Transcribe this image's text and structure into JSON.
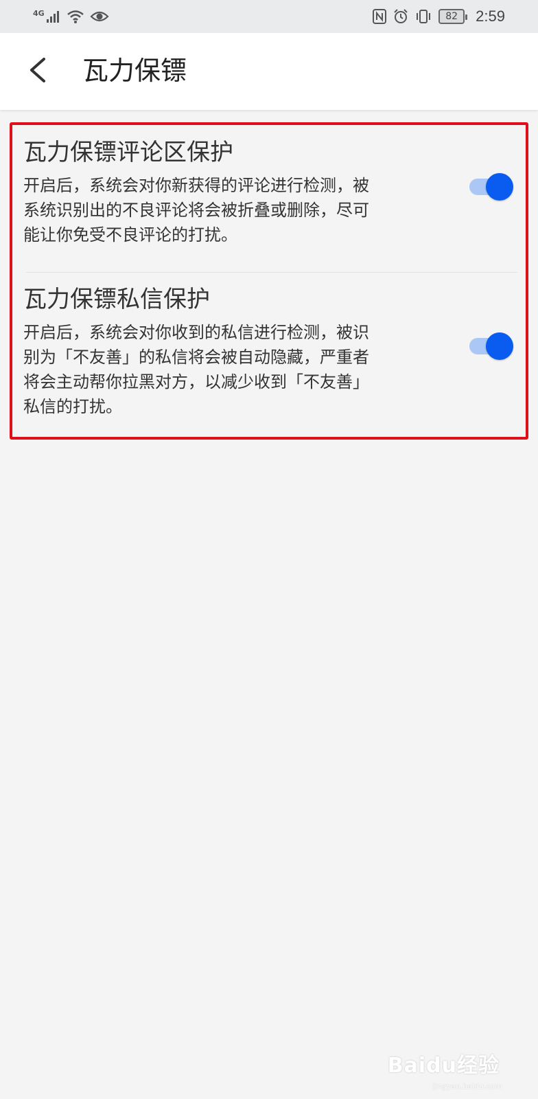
{
  "status_bar": {
    "network": "4G",
    "battery": "82",
    "time": "2:59"
  },
  "header": {
    "title": "瓦力保镖"
  },
  "settings": [
    {
      "title": "瓦力保镖评论区保护",
      "desc_lines": [
        "开启后，系统会对你新获得的评论进行检测，被",
        "系统识别出的不良评论将会被折叠或删除，尽可",
        "能让你免受不良评论的打扰。"
      ],
      "enabled": true
    },
    {
      "title": "瓦力保镖私信保护",
      "desc_lines": [
        "开启后，系统会对你收到的私信进行检测，被识",
        "别为「不友善」的私信将会被自动隐藏，严重者",
        "将会主动帮你拉黑对方，以减少收到「不友善」",
        "私信的打扰。"
      ],
      "enabled": true
    }
  ],
  "colors": {
    "accent": "#0a5cf0",
    "highlight_border": "#e0101b"
  },
  "watermark": {
    "brand": "Baidu经验",
    "url": "jingyan.baidu.com"
  }
}
